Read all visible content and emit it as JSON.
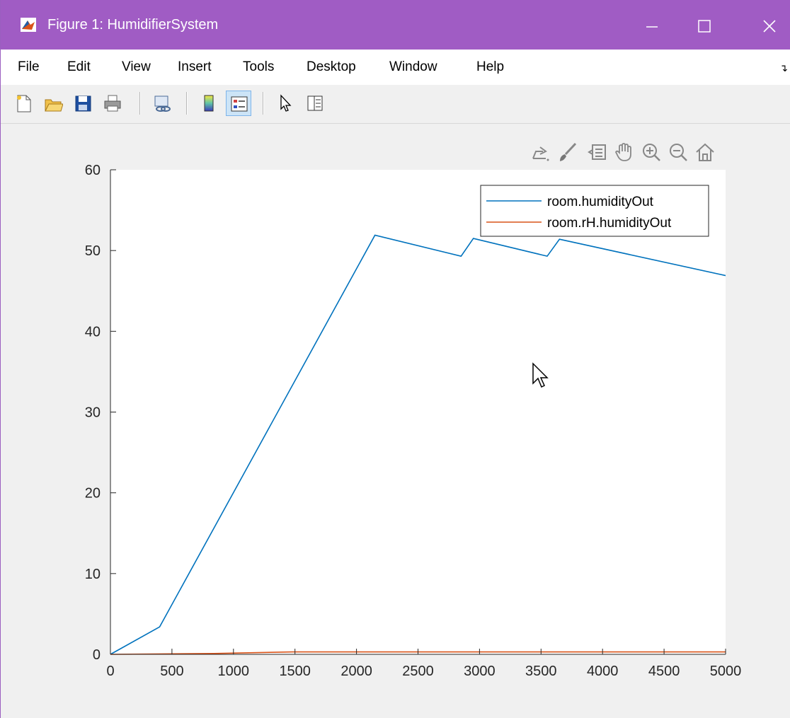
{
  "window": {
    "title": "Figure 1: HumidifierSystem",
    "controls": [
      "minimize",
      "maximize",
      "close"
    ]
  },
  "menubar": {
    "items": [
      "File",
      "Edit",
      "View",
      "Insert",
      "Tools",
      "Desktop",
      "Window",
      "Help"
    ]
  },
  "toolbar": {
    "buttons": [
      "new-figure-icon",
      "open-file-icon",
      "save-icon",
      "print-icon",
      "link-plot-icon",
      "colorbar-icon",
      "legend-icon",
      "edit-plot-arrow-icon",
      "property-inspector-icon"
    ],
    "active": "legend-icon"
  },
  "axes_toolbar": {
    "buttons": [
      "export-icon",
      "brush-icon",
      "data-tips-icon",
      "pan-hand-icon",
      "zoom-in-icon",
      "zoom-out-icon",
      "restore-view-home-icon"
    ]
  },
  "colors": {
    "series1": "#1f77b4",
    "series2": "#d95319",
    "titlebar": "#a05cc4"
  },
  "chart_data": {
    "type": "line",
    "title": "",
    "xlabel": "",
    "ylabel": "",
    "xlim": [
      0,
      5000
    ],
    "ylim": [
      0,
      60
    ],
    "xticks": [
      "0",
      "500",
      "1000",
      "1500",
      "2000",
      "2500",
      "3000",
      "3500",
      "4000",
      "4500",
      "5000"
    ],
    "yticks": [
      "0",
      "10",
      "20",
      "30",
      "40",
      "50",
      "60"
    ],
    "grid": false,
    "legend_position": "top-right",
    "series": [
      {
        "name": "room.humidityOut",
        "color": "#0072bd",
        "x": [
          0,
          400,
          2150,
          2850,
          2950,
          3550,
          3650,
          5000
        ],
        "y": [
          0,
          3.4,
          51.9,
          49.3,
          51.5,
          49.3,
          51.4,
          46.9
        ]
      },
      {
        "name": "room.rH.humidityOut",
        "color": "#d95319",
        "x": [
          0,
          840,
          1480,
          5000
        ],
        "y": [
          0,
          0.1,
          0.3,
          0.3
        ]
      }
    ]
  }
}
